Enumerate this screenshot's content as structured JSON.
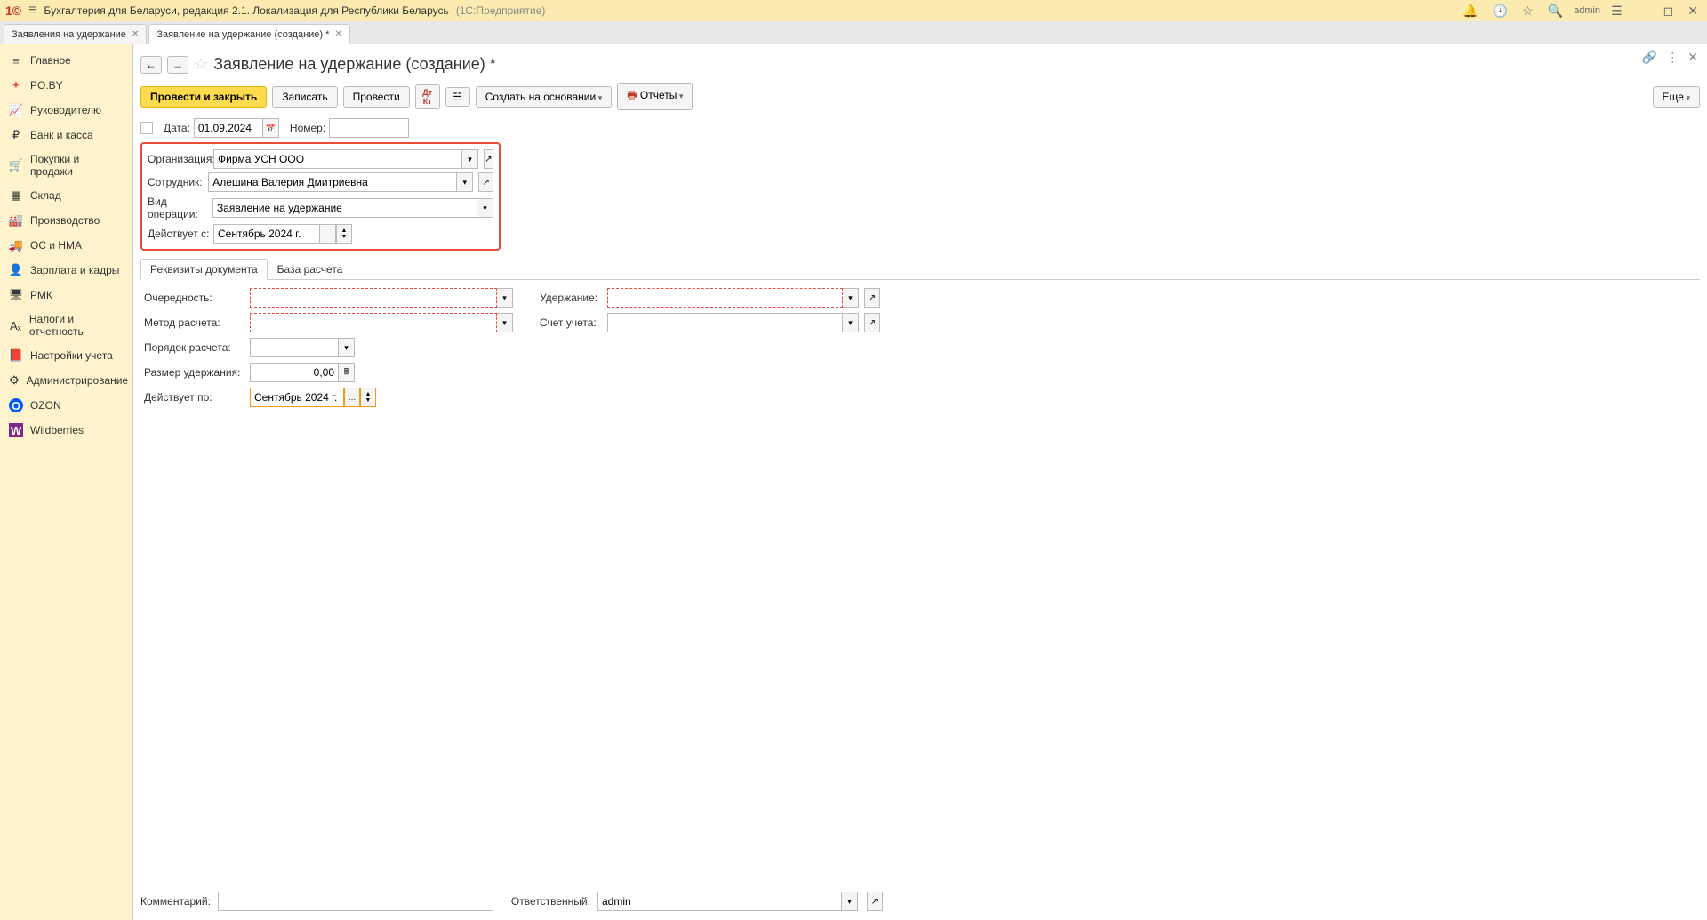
{
  "titlebar": {
    "logo": "1©",
    "title": "Бухгалтерия для Беларуси, редакция 2.1. Локализация для Республики Беларусь",
    "subtitle": "(1С:Предприятие)",
    "user": "admin"
  },
  "tabs": [
    {
      "label": "Заявления на удержание"
    },
    {
      "label": "Заявление на удержание (создание) *"
    }
  ],
  "sidebar": [
    {
      "label": "Главное",
      "icon": "≡"
    },
    {
      "label": "PO.BY",
      "icon": "✦"
    },
    {
      "label": "Руководителю",
      "icon": "📈"
    },
    {
      "label": "Банк и касса",
      "icon": "₽"
    },
    {
      "label": "Покупки и продажи",
      "icon": "🛒"
    },
    {
      "label": "Склад",
      "icon": "▦"
    },
    {
      "label": "Производство",
      "icon": "🏭"
    },
    {
      "label": "ОС и НМА",
      "icon": "🚚"
    },
    {
      "label": "Зарплата и кадры",
      "icon": "👤"
    },
    {
      "label": "РМК",
      "icon": "🖥"
    },
    {
      "label": "Налоги и отчетность",
      "icon": "Aₓ"
    },
    {
      "label": "Настройки учета",
      "icon": "📕"
    },
    {
      "label": "Администрирование",
      "icon": "⚙"
    },
    {
      "label": "OZON",
      "icon": "O"
    },
    {
      "label": "Wildberries",
      "icon": "W"
    }
  ],
  "page": {
    "title": "Заявление на удержание (создание) *"
  },
  "toolbar": {
    "post_close": "Провести и закрыть",
    "save": "Записать",
    "post": "Провести",
    "create_based": "Создать на основании",
    "reports": "Отчеты",
    "more": "Еще"
  },
  "header_fields": {
    "date_label": "Дата:",
    "date_value": "01.09.2024",
    "number_label": "Номер:",
    "number_value": ""
  },
  "main_fields": {
    "org_label": "Организация:",
    "org_value": "Фирма УСН ООО",
    "employee_label": "Сотрудник:",
    "employee_value": "Алешина Валерия Дмитриевна",
    "op_type_label": "Вид операции:",
    "op_type_value": "Заявление на удержание",
    "valid_from_label": "Действует с:",
    "valid_from_value": "Сентябрь 2024 г."
  },
  "inner_tabs": {
    "tab1": "Реквизиты документа",
    "tab2": "База расчета"
  },
  "details": {
    "priority_label": "Очередность:",
    "priority_value": "",
    "method_label": "Метод расчета:",
    "method_value": "",
    "order_label": "Порядок расчета:",
    "order_value": "",
    "amount_label": "Размер удержания:",
    "amount_value": "0,00",
    "valid_to_label": "Действует по:",
    "valid_to_value": "Сентябрь 2024 г.",
    "withholding_label": "Удержание:",
    "withholding_value": "",
    "account_label": "Счет учета:",
    "account_value": ""
  },
  "footer": {
    "comment_label": "Комментарий:",
    "comment_value": "",
    "responsible_label": "Ответственный:",
    "responsible_value": "admin"
  }
}
